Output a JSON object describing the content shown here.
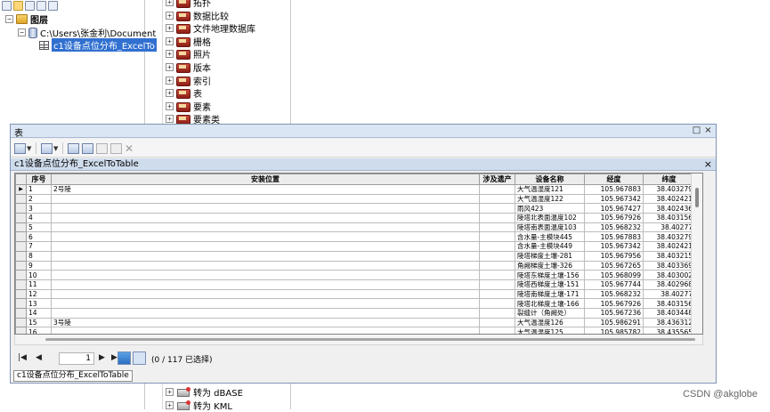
{
  "toc": {
    "root_label": "图层",
    "db_path": "C:\\Users\\张金利\\Document",
    "table_name": "c1设备点位分布_ExcelTo",
    "expand_minus": "−"
  },
  "toolbox": {
    "items": [
      {
        "label": "拓扑",
        "icon": "toolset-icon"
      },
      {
        "label": "数据比较",
        "icon": "toolset-icon"
      },
      {
        "label": "文件地理数据库",
        "icon": "toolset-icon"
      },
      {
        "label": "栅格",
        "icon": "toolset-icon"
      },
      {
        "label": "照片",
        "icon": "toolset-icon"
      },
      {
        "label": "版本",
        "icon": "toolset-icon"
      },
      {
        "label": "索引",
        "icon": "toolset-icon"
      },
      {
        "label": "表",
        "icon": "toolset-icon"
      },
      {
        "label": "要素",
        "icon": "toolset-icon"
      },
      {
        "label": "要素类",
        "icon": "toolset-icon"
      }
    ],
    "bottom_items": [
      {
        "label": "转为 dBASE",
        "icon": "conversion-icon"
      },
      {
        "label": "转为 KML",
        "icon": "conversion-icon"
      }
    ],
    "expand_plus": "+"
  },
  "table_window": {
    "title": "表",
    "restore_glyph": "□",
    "close_glyph": "×",
    "tab_name": "c1设备点位分布_ExcelToTable",
    "tab_close_glyph": "×",
    "columns": [
      "序号",
      "安装位置",
      "涉及遗产",
      "设备名称",
      "经度",
      "纬度"
    ],
    "rows": [
      [
        "1",
        "2号陵",
        "",
        "大气温湿度121",
        "105.967883",
        "38.403279"
      ],
      [
        "2",
        "",
        "",
        "大气温湿度122",
        "105.967342",
        "38.402421"
      ],
      [
        "3",
        "",
        "",
        "雨风423",
        "105.967427",
        "38.402436"
      ],
      [
        "4",
        "",
        "",
        "陵塔北表面温度102",
        "105.967926",
        "38.403156"
      ],
      [
        "5",
        "",
        "",
        "陵塔南表面温度103",
        "105.968232",
        "38.40277"
      ],
      [
        "6",
        "",
        "",
        "含水量-主模块445",
        "105.967883",
        "38.403279"
      ],
      [
        "7",
        "",
        "",
        "含水量-主模块449",
        "105.967342",
        "38.402421"
      ],
      [
        "8",
        "",
        "",
        "陵塔梯度土壤-281",
        "105.967956",
        "38.403215"
      ],
      [
        "9",
        "",
        "",
        "角阙梯度土壤-326",
        "105.967265",
        "38.403369"
      ],
      [
        "10",
        "",
        "",
        "陵塔东梯度土壤-156",
        "105.968099",
        "38.403002"
      ],
      [
        "11",
        "",
        "",
        "陵塔西梯度土壤-151",
        "105.967744",
        "38.402968"
      ],
      [
        "12",
        "",
        "",
        "陵塔南梯度土壤-171",
        "105.968232",
        "38.40277"
      ],
      [
        "13",
        "",
        "",
        "陵塔北梯度土壤-166",
        "105.967926",
        "38.403156"
      ],
      [
        "14",
        "",
        "",
        "裂缝计（角阙处）",
        "105.967236",
        "38.403448"
      ],
      [
        "15",
        "3号陵",
        "",
        "大气温湿度126",
        "105.986291",
        "38.436312"
      ],
      [
        "16",
        "",
        "",
        "大气温湿度125",
        "105.985782",
        "38.435565"
      ]
    ],
    "current_row_marker": "▶",
    "nav": {
      "first": "|◀",
      "prev": "◀",
      "record": "1",
      "next": "▶",
      "last": "▶|",
      "count_text": "(0 / 117 已选择)"
    },
    "bottom_tab": "c1设备点位分布_ExcelToTable"
  },
  "watermark": "CSDN @akglobe",
  "colors": {
    "selection": "#3170d0",
    "title_bar": "#dbe6f4",
    "tab_strip": "#cfdcec"
  }
}
